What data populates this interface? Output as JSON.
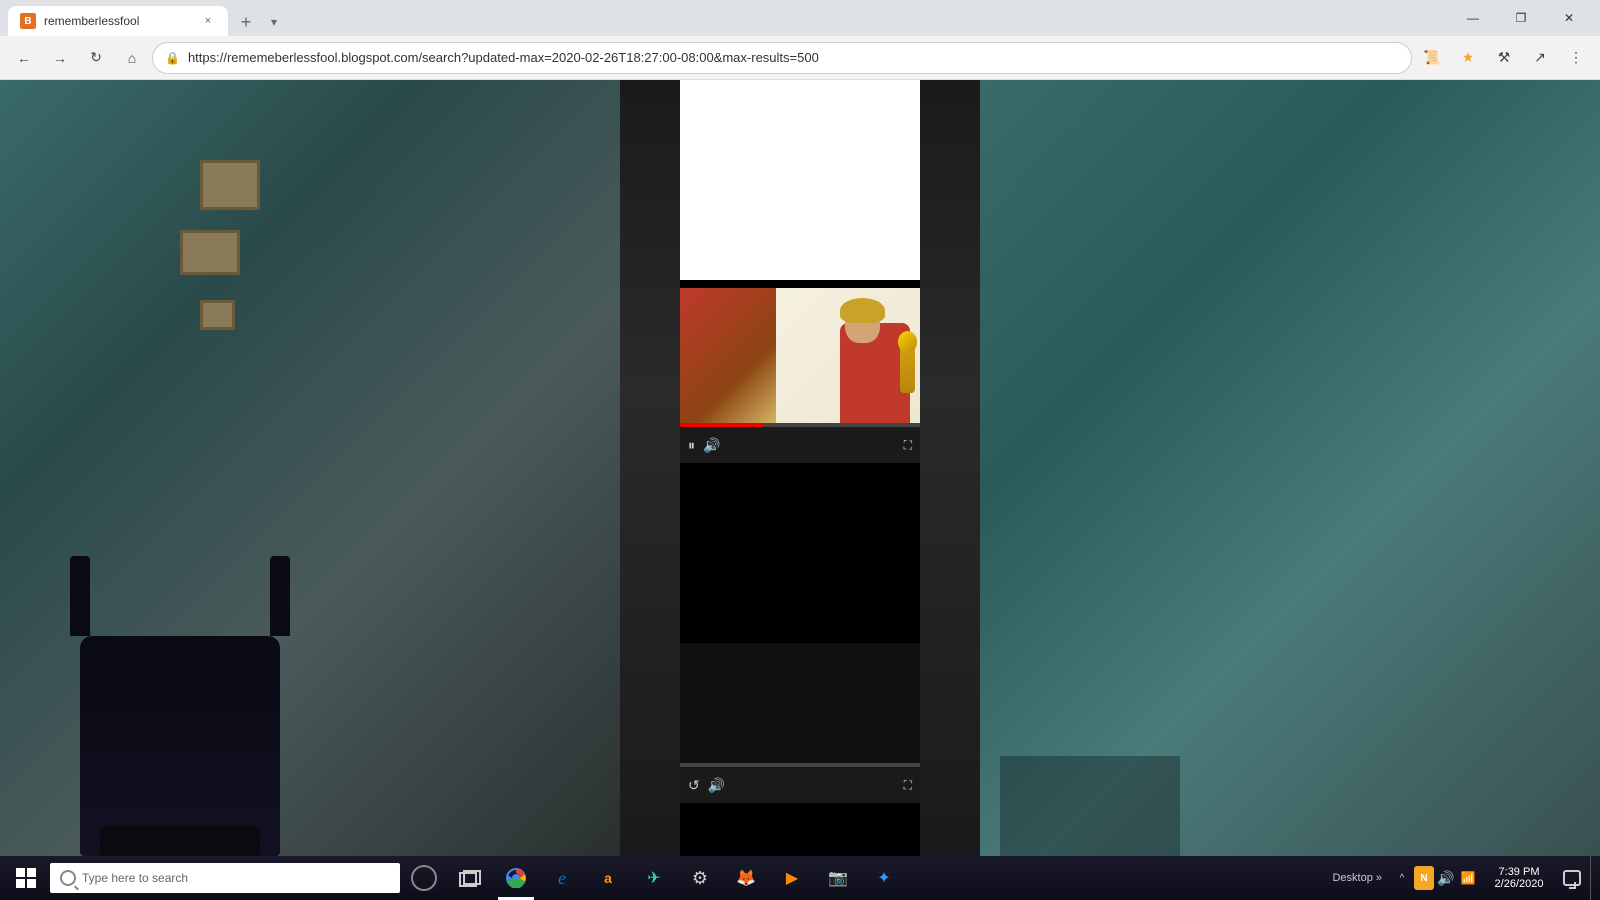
{
  "browser": {
    "tab": {
      "favicon": "B",
      "title": "rememberlessfool",
      "close_label": "×"
    },
    "new_tab_label": "+",
    "tab_list_label": "▾",
    "window_controls": {
      "minimize": "—",
      "maximize": "❐",
      "close": "✕"
    },
    "nav": {
      "back_disabled": false,
      "forward_disabled": false,
      "reload": "↻",
      "home": "⌂",
      "url": "https://rememeberlessfool.blogspot.com/search?updated-max=2020-02-26T18:27:00-08:00&max-results=500",
      "reader_mode": "☰",
      "bookmark": "★",
      "toolbar_btn": "≡",
      "share_btn": "↗"
    }
  },
  "video_player_1": {
    "progress_percent": 35,
    "controls": {
      "pause_label": "⏸",
      "volume_label": "🔊",
      "fullscreen_label": "⛶"
    }
  },
  "video_player_2": {
    "progress_percent": 0,
    "controls": {
      "replay_label": "↺",
      "volume_label": "🔊",
      "fullscreen_label": "⛶"
    }
  },
  "taskbar": {
    "start_label": "",
    "search_placeholder": "Type here to search",
    "cortana_label": "",
    "taskview_label": "",
    "pinned_icons": [
      {
        "name": "edge-browser",
        "symbol": "e",
        "active": true
      },
      {
        "name": "cortana",
        "symbol": "○",
        "active": false
      },
      {
        "name": "task-view",
        "symbol": "⧉",
        "active": false
      },
      {
        "name": "ie-browser",
        "symbol": "e",
        "active": false
      },
      {
        "name": "edge-icon",
        "symbol": "⊕",
        "active": false
      },
      {
        "name": "amazon",
        "symbol": "a",
        "active": false
      },
      {
        "name": "tripadvisor",
        "symbol": "✈",
        "active": false
      },
      {
        "name": "settings",
        "symbol": "⚙",
        "active": false
      },
      {
        "name": "firefox",
        "symbol": "◉",
        "active": false
      },
      {
        "name": "vlc",
        "symbol": "▶",
        "active": false
      },
      {
        "name": "camera",
        "symbol": "📷",
        "active": false
      },
      {
        "name": "unknown-app",
        "symbol": "✦",
        "active": false
      }
    ],
    "system_tray": {
      "expand_label": "^",
      "norton_label": "N",
      "volume_label": "🔊",
      "network_label": "📶",
      "battery_label": "⚡"
    },
    "clock": {
      "time": "7:39 PM",
      "date": "2/26/2020"
    },
    "desktop_label": "",
    "notification_label": "💬",
    "desktop_right_label": "Desktop »"
  }
}
